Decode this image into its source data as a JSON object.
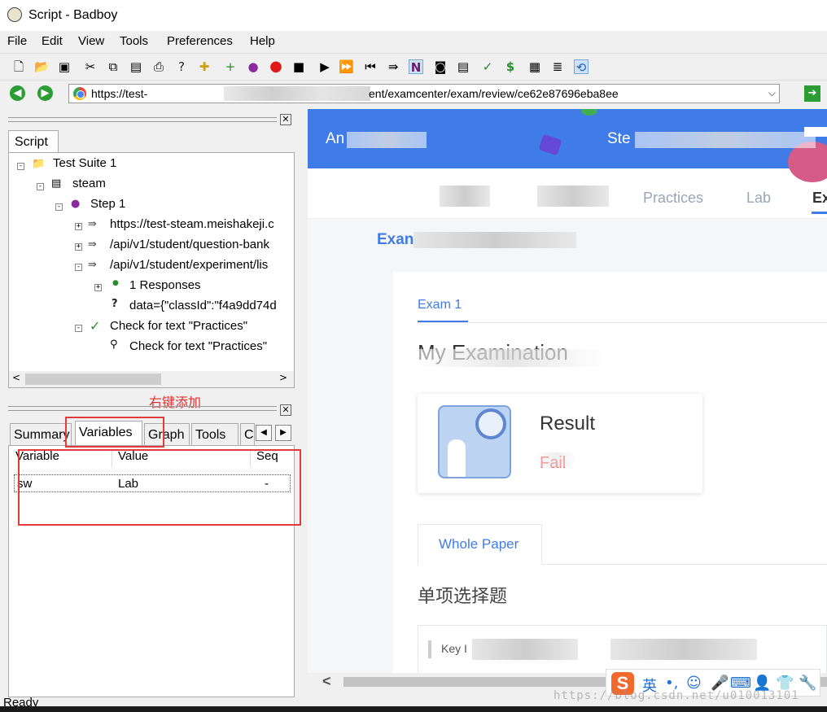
{
  "window": {
    "title": "Script - Badboy"
  },
  "menu": [
    "File",
    "Edit",
    "View",
    "Tools",
    "Preferences",
    "Help"
  ],
  "address": {
    "url_prefix": "https://test-",
    "url_suffix": "ent/examcenter/exam/review/ce62e87696eba8ee"
  },
  "script_panel": {
    "tab": "Script",
    "tree": [
      "Test Suite 1",
      "steam",
      "Step 1",
      "https://test-steam.meishakeji.c",
      "/api/v1/student/question-bank",
      "/api/v1/student/experiment/lis",
      "1 Responses",
      "data={\"classId\":\"f4a9dd74d",
      "Check for text \"Practices\"",
      "Check for text \"Practices\""
    ]
  },
  "annotation": "右键添加",
  "bottom_panel": {
    "tabs": [
      "Summary",
      "Variables",
      "Graph",
      "Tools",
      "C"
    ],
    "columns": [
      "Variable",
      "Value",
      "Seq"
    ],
    "rows": [
      {
        "variable": "sw",
        "value": "Lab",
        "seq": "-"
      }
    ]
  },
  "page": {
    "banner_left": "An",
    "banner_right": "Ste",
    "nav": [
      "Practices",
      "Lab",
      "Ex"
    ],
    "breadcrumb": "Exan",
    "exam_tab": "Exam 1",
    "exam_title": "My Examination",
    "result_label": "Result",
    "result_value": "Fail",
    "whole_paper": "Whole Paper",
    "section_title": "单项选择题",
    "question_key": "Key I"
  },
  "ime": {
    "lang": "英"
  },
  "status": {
    "text": "Ready",
    "watermark": "https://blog.csdn.net/u010013101"
  }
}
